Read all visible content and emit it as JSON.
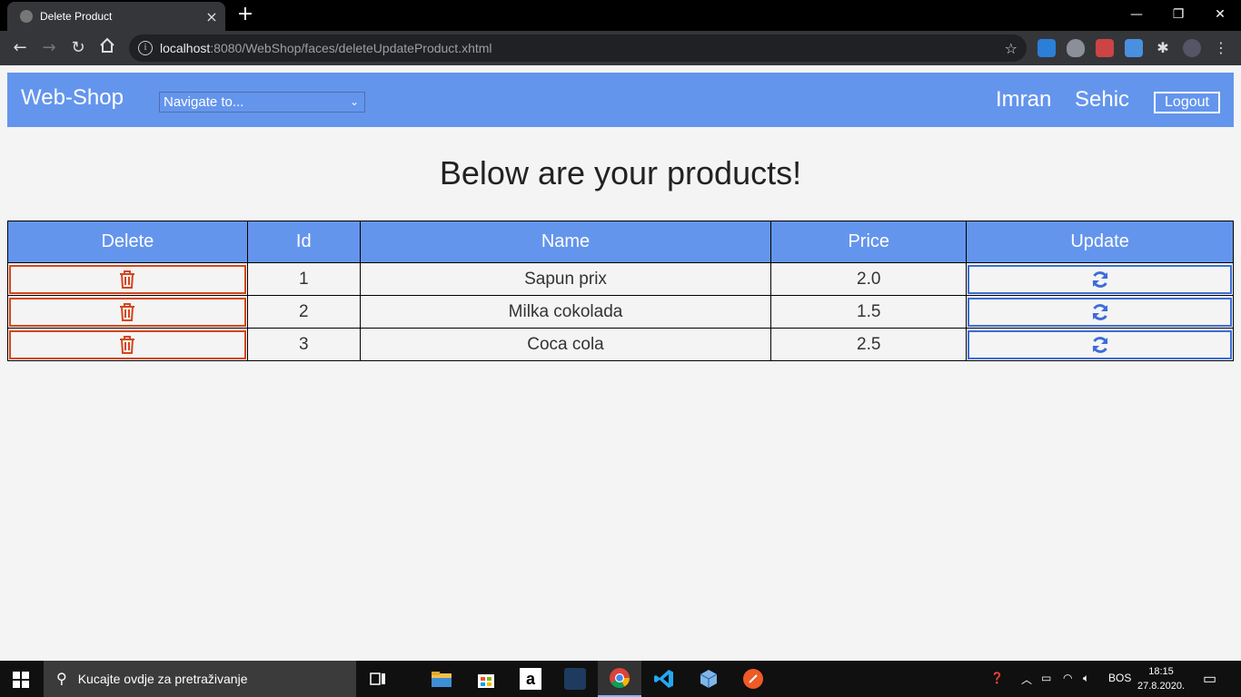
{
  "browser": {
    "tab_title": "Delete Product",
    "new_tab": "+",
    "tab_close": "×",
    "url_host": "localhost",
    "url_rest": ":8080/WebShop/faces/deleteUpdateProduct.xhtml",
    "window_minimize": "—",
    "window_restore": "❐",
    "window_close": "✕"
  },
  "header": {
    "brand": "Web-Shop",
    "navigate_placeholder": "Navigate to...",
    "user_first": "Imran",
    "user_last": "Sehic",
    "logout_label": "Logout",
    "bg_color": "#6495ed"
  },
  "main": {
    "heading": "Below are your products!"
  },
  "table": {
    "headers": [
      "Delete",
      "Id",
      "Name",
      "Price",
      "Update"
    ],
    "rows": [
      {
        "id": "1",
        "name": "Sapun prix",
        "price": "2.0"
      },
      {
        "id": "2",
        "name": "Milka cokolada",
        "price": "1.5"
      },
      {
        "id": "3",
        "name": "Coca cola",
        "price": "2.5"
      }
    ],
    "delete_color": "#d4461a",
    "update_color": "#3d6cd8"
  },
  "taskbar": {
    "search_placeholder": "Kucajte ovdje za pretraživanje",
    "language": "BOS",
    "time": "18:15",
    "date": "27.8.2020."
  }
}
